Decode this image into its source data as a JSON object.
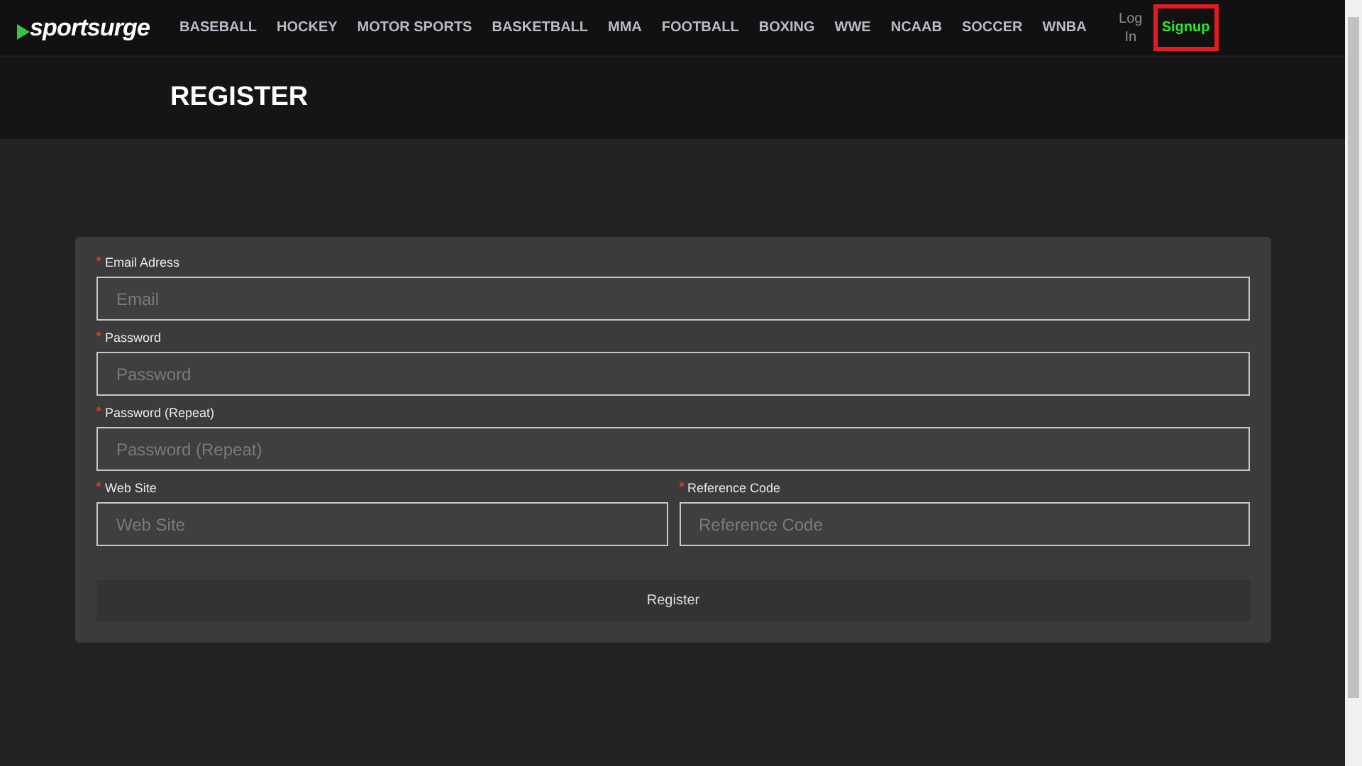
{
  "brand": {
    "name": "sportsurge"
  },
  "nav": [
    {
      "label": "BASEBALL"
    },
    {
      "label": "HOCKEY"
    },
    {
      "label": "MOTOR SPORTS"
    },
    {
      "label": "BASKETBALL"
    },
    {
      "label": "MMA"
    },
    {
      "label": "FOOTBALL"
    },
    {
      "label": "BOXING"
    },
    {
      "label": "WWE"
    },
    {
      "label": "NCAAB"
    },
    {
      "label": "SOCCER"
    },
    {
      "label": "WNBA"
    }
  ],
  "auth": [
    {
      "kind": "login",
      "label": "Log In",
      "highlighted": false
    },
    {
      "kind": "signup",
      "label": "Signup",
      "highlighted": true
    }
  ],
  "page_title": "REGISTER",
  "form": {
    "rows": [
      [
        {
          "label": "Email Adress",
          "placeholder": "Email",
          "required": true
        }
      ],
      [
        {
          "label": "Password",
          "placeholder": "Password",
          "required": true
        }
      ],
      [
        {
          "label": "Password (Repeat)",
          "placeholder": "Password (Repeat)",
          "required": true
        }
      ],
      [
        {
          "label": "Web Site",
          "placeholder": "Web Site",
          "required": true
        },
        {
          "label": "Reference Code",
          "placeholder": "Reference Code",
          "required": true
        }
      ]
    ],
    "submit": "Register"
  }
}
